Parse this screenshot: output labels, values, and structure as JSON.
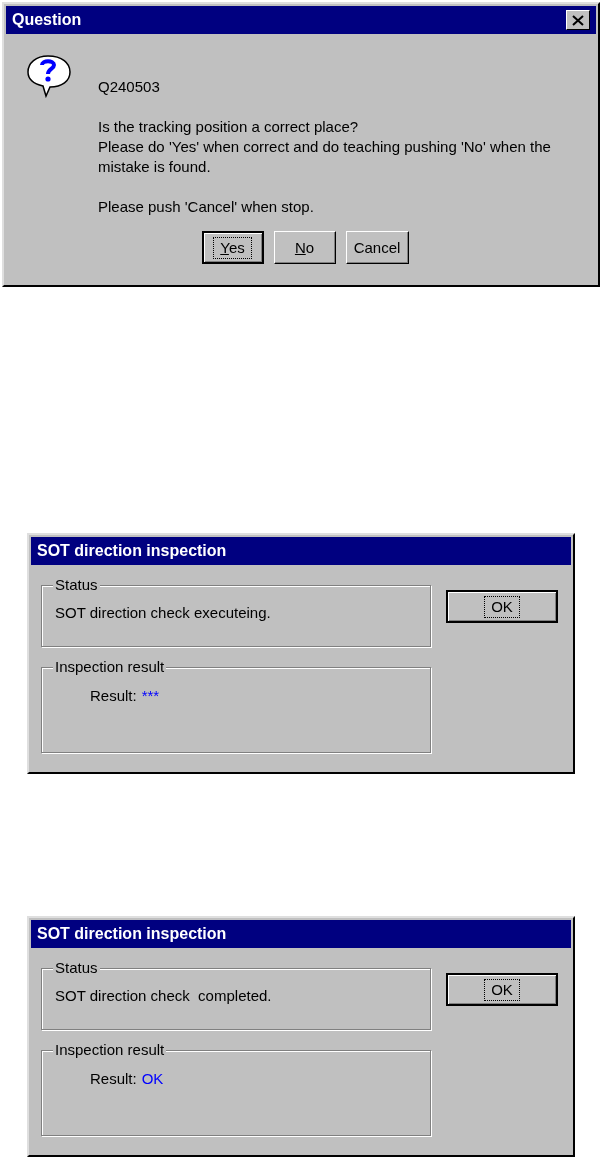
{
  "dialogs": [
    {
      "kind": "question",
      "title": "Question",
      "has_close": true,
      "code": "Q240503",
      "paragraphs": [
        "Is the tracking position a correct place?",
        "Please do 'Yes' when correct and do teaching pushing 'No' when the mistake is found.",
        "Please push 'Cancel' when stop."
      ],
      "buttons": [
        {
          "label": "Yes",
          "default": true,
          "underline_first": true
        },
        {
          "label": "No",
          "default": false,
          "underline_first": true
        },
        {
          "label": "Cancel",
          "default": false,
          "underline_first": false
        }
      ]
    },
    {
      "kind": "inspection",
      "title": "SOT direction inspection",
      "has_close": false,
      "status_label": "Status",
      "status_text": "SOT direction check executeing.",
      "result_group": "Inspection result",
      "result_label": "Result:",
      "result_value": "***",
      "button": {
        "label": "OK",
        "default": true,
        "underline_first": false
      }
    },
    {
      "kind": "inspection",
      "title": "SOT direction inspection",
      "has_close": false,
      "status_label": "Status",
      "status_text": "SOT direction check  completed.",
      "result_group": "Inspection result",
      "result_label": "Result:",
      "result_value": "OK",
      "button": {
        "label": "OK",
        "default": true,
        "underline_first": false
      }
    }
  ]
}
